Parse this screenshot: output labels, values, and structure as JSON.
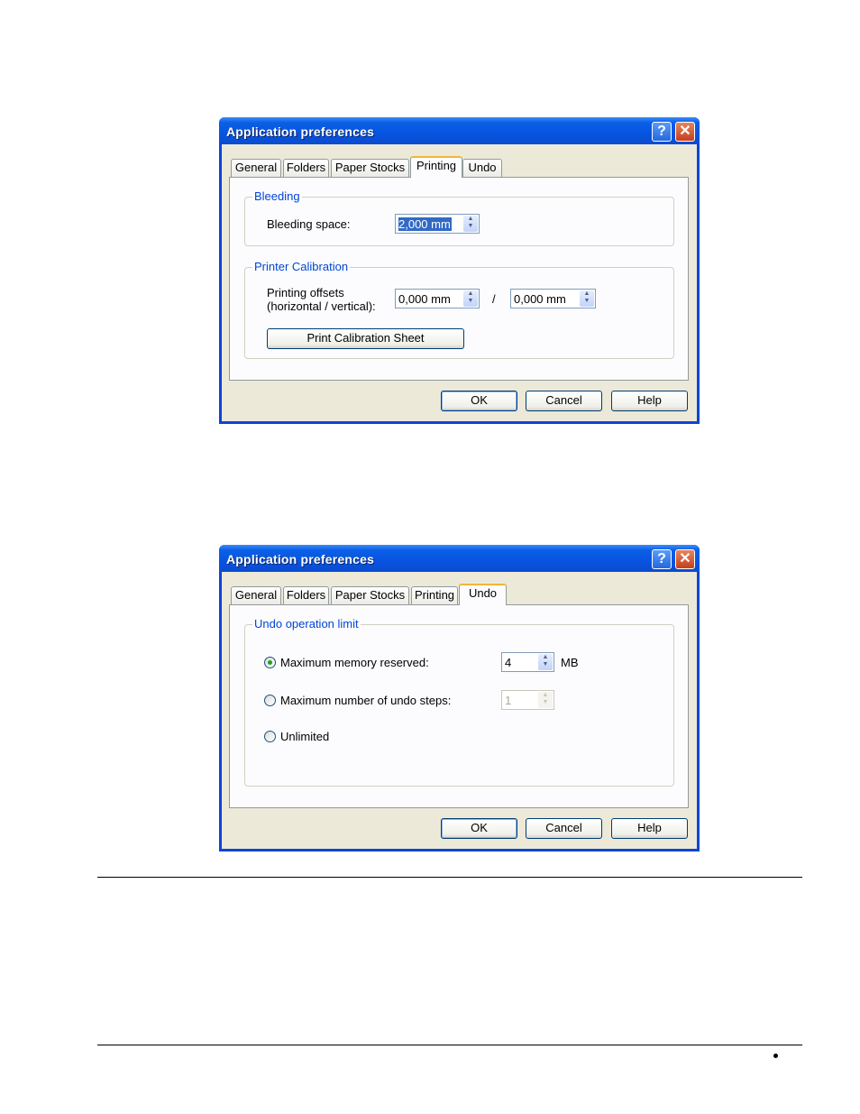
{
  "dialogs": [
    {
      "title": "Application preferences",
      "help_glyph": "?",
      "close_glyph": "✕",
      "tabs": [
        "General",
        "Folders",
        "Paper Stocks",
        "Printing",
        "Undo"
      ],
      "active_tab": "Printing",
      "groups": {
        "bleeding": {
          "title": "Bleeding",
          "label": "Bleeding space:",
          "value": "2,000 mm"
        },
        "calibration": {
          "title": "Printer Calibration",
          "label_line1": "Printing offsets",
          "label_line2": "(horizontal / vertical):",
          "horizontal": "0,000 mm",
          "separator": "/",
          "vertical": "0,000 mm",
          "button": "Print Calibration Sheet"
        }
      },
      "buttons": {
        "ok": "OK",
        "cancel": "Cancel",
        "help": "Help"
      }
    },
    {
      "title": "Application preferences",
      "help_glyph": "?",
      "close_glyph": "✕",
      "tabs": [
        "General",
        "Folders",
        "Paper Stocks",
        "Printing",
        "Undo"
      ],
      "active_tab": "Undo",
      "groups": {
        "undo": {
          "title": "Undo operation limit",
          "options": [
            {
              "label": "Maximum memory reserved:",
              "selected": true,
              "value": "4",
              "unit": "MB",
              "enabled": true
            },
            {
              "label": "Maximum number of undo steps:",
              "selected": false,
              "value": "1",
              "enabled": false
            },
            {
              "label": "Unlimited",
              "selected": false
            }
          ]
        }
      },
      "buttons": {
        "ok": "OK",
        "cancel": "Cancel",
        "help": "Help"
      }
    }
  ],
  "icons": {
    "spin_arrows": "⯅⯆"
  }
}
